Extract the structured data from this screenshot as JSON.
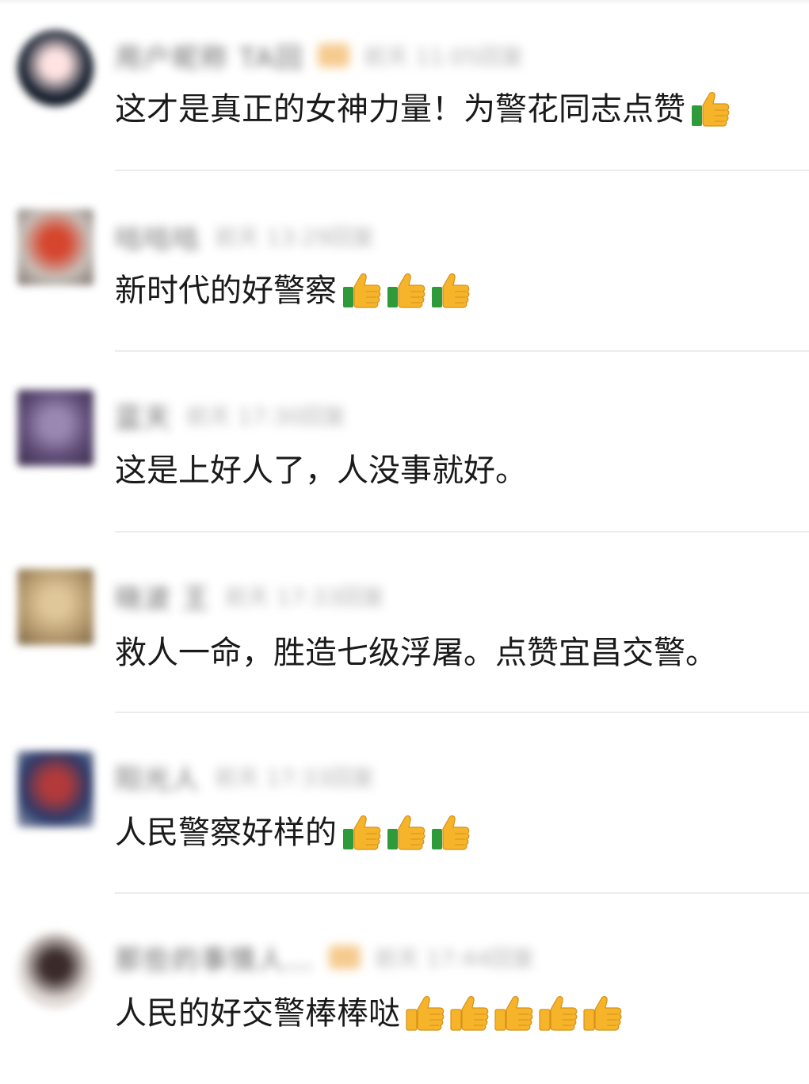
{
  "comments": [
    {
      "nickname": "用户昵称 TA回",
      "time": "前天 11:05回复",
      "vip": true,
      "text": "这才是真正的女神力量！为警花同志点赞",
      "thumbs": 1,
      "thumb_style": "green",
      "avatar_colors": [
        "#0f1b2a",
        "#ffe3e3",
        "#2a1a1a"
      ]
    },
    {
      "nickname": "咕咕咕",
      "time": "前天 13:29回复",
      "vip": false,
      "text": "新时代的好警察",
      "thumbs": 3,
      "thumb_style": "green",
      "avatar_colors": [
        "#c8c1bb",
        "#d6452d",
        "#7c6f6a"
      ]
    },
    {
      "nickname": "蓝天",
      "time": "前天 17:30回复",
      "vip": false,
      "text": "这是上好人了，人没事就好。",
      "thumbs": 0,
      "thumb_style": "green",
      "avatar_colors": [
        "#5c4a74",
        "#9a88b2",
        "#3b2d4a"
      ]
    },
    {
      "nickname": "晓波 王",
      "time": "前天 17:33回复",
      "vip": false,
      "text": "救人一命，胜造七级浮屠。点赞宜昌交警。",
      "thumbs": 0,
      "thumb_style": "green",
      "avatar_colors": [
        "#b59a6e",
        "#e0c79a",
        "#7a6444"
      ]
    },
    {
      "nickname": "阳光人",
      "time": "前天 17:33回复",
      "vip": false,
      "text": "人民警察好样的",
      "thumbs": 3,
      "thumb_style": "green",
      "avatar_colors": [
        "#2a3a6a",
        "#b23a3a",
        "#9aa2b5"
      ]
    },
    {
      "nickname": "那些的事情人…",
      "time": "前天 17:44回复",
      "vip": true,
      "text": "人民的好交警棒棒哒",
      "thumbs": 5,
      "thumb_style": "yellow",
      "avatar_colors": [
        "#e9e4df",
        "#3a2a2a",
        "#c7b4ae"
      ]
    }
  ],
  "colors": {
    "text": "#1a1a1a",
    "divider": "#ececec",
    "thumb_yellow": "#f6b42a",
    "thumb_green_cuff": "#2f9a3a"
  }
}
